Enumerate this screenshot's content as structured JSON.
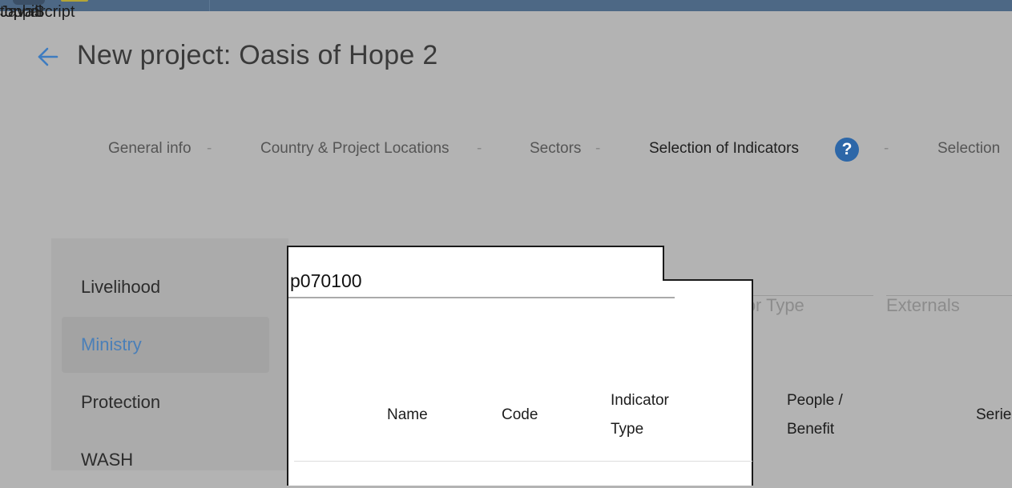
{
  "topbar": {
    "overlap_texts": [
      "topbar",
      "toppill",
      "JavaScript"
    ],
    "logo_icon": "logo-icon",
    "accent_colors": {
      "bar": "#4d6885",
      "logo_text": "#b3a436"
    }
  },
  "header": {
    "back_icon": "arrow-left-icon",
    "title": "New project: Oasis of Hope 2",
    "accent": "#4a7fb8"
  },
  "steps": [
    {
      "label": "General info",
      "active": false
    },
    {
      "label": "Country & Project Locations",
      "active": false
    },
    {
      "label": "Sectors",
      "active": false
    },
    {
      "label": "Selection of Indicators",
      "active": true,
      "help_icon": "?"
    },
    {
      "label": "Selection",
      "active": false
    }
  ],
  "step_separator": "-",
  "sectors": [
    {
      "label": "Livelihood",
      "active": false
    },
    {
      "label": "Ministry",
      "active": true
    },
    {
      "label": "Protection",
      "active": false
    },
    {
      "label": "WASH",
      "active": false
    }
  ],
  "filters": {
    "indicator_type_label": "Indicator Type",
    "externals_label": "Externals"
  },
  "search_popup": {
    "value": "p070100",
    "columns": [
      "Name",
      "Code",
      "Indicator Type"
    ]
  },
  "background_table": {
    "columns": [
      "People / Benefit",
      "Serie"
    ]
  },
  "colors": {
    "help_icon": "#2d67a8",
    "active_sector_bg": "#a3a3a3",
    "overlay_bg": "#b3b3b3"
  }
}
